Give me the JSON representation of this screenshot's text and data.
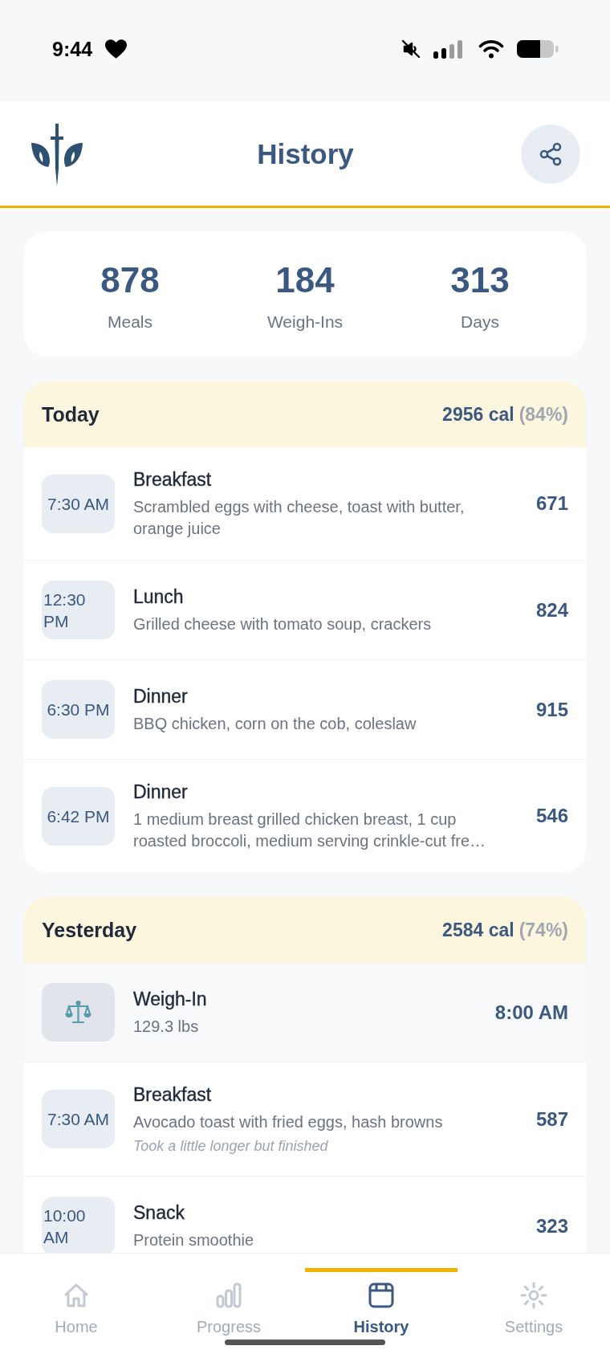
{
  "status_bar": {
    "time": "9:44"
  },
  "header": {
    "title": "History"
  },
  "stats": [
    {
      "value": "878",
      "label": "Meals"
    },
    {
      "value": "184",
      "label": "Weigh-Ins"
    },
    {
      "value": "313",
      "label": "Days"
    }
  ],
  "days": [
    {
      "label": "Today",
      "calories": "2956 cal",
      "percent": "(84%)",
      "entries": [
        {
          "kind": "meal",
          "time": "7:30 AM",
          "title": "Breakfast",
          "detail": "Scrambled eggs with cheese, toast with butter, orange juice",
          "value": "671"
        },
        {
          "kind": "meal",
          "time": "12:30 PM",
          "title": "Lunch",
          "detail": "Grilled cheese with tomato soup, crackers",
          "value": "824"
        },
        {
          "kind": "meal",
          "time": "6:30 PM",
          "title": "Dinner",
          "detail": "BBQ chicken, corn on the cob, coleslaw",
          "value": "915"
        },
        {
          "kind": "meal",
          "time": "6:42 PM",
          "title": "Dinner",
          "detail": "1 medium breast grilled chicken breast, 1 cup roasted broccoli, medium serving crinkle-cut fre…",
          "value": "546"
        }
      ]
    },
    {
      "label": "Yesterday",
      "calories": "2584 cal",
      "percent": "(74%)",
      "entries": [
        {
          "kind": "weigh_in",
          "title": "Weigh-In",
          "detail": "129.3 lbs",
          "value": "8:00 AM"
        },
        {
          "kind": "meal",
          "time": "7:30 AM",
          "title": "Breakfast",
          "detail": "Avocado toast with fried eggs, hash browns",
          "note": "Took a little longer but finished",
          "value": "587"
        },
        {
          "kind": "meal",
          "time": "10:00 AM",
          "title": "Snack",
          "detail": "Protein smoothie",
          "value": "323"
        }
      ]
    }
  ],
  "nav": {
    "tabs": [
      {
        "label": "Home",
        "selected": false
      },
      {
        "label": "Progress",
        "selected": false
      },
      {
        "label": "History",
        "selected": true
      },
      {
        "label": "Settings",
        "selected": false
      }
    ]
  }
}
